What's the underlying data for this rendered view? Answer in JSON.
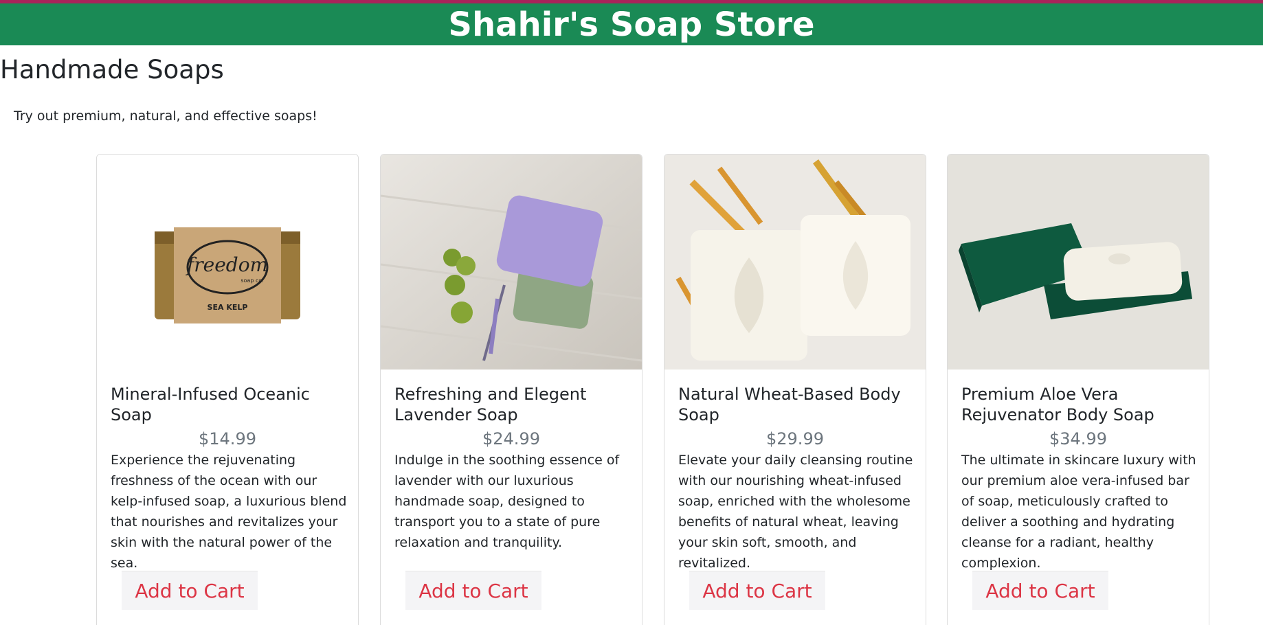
{
  "header": {
    "title": "Shahir's Soap Store"
  },
  "page": {
    "heading": "Handmade Soaps",
    "tagline": "Try out premium, natural, and effective soaps!"
  },
  "products": [
    {
      "title": "Mineral-Infused Oceanic Soap",
      "price": "$14.99",
      "description": "Experience the rejuvenating freshness of the ocean with our kelp-infused soap, a luxurious blend that nourishes and revitalizes your skin with the natural power of the sea.",
      "button": "Add to Cart",
      "image_label": "freedom",
      "image_label_small": "soap co.",
      "image_label_sub": "SEA KELP"
    },
    {
      "title": "Refreshing and Elegent Lavender Soap",
      "price": "$24.99",
      "description": "Indulge in the soothing essence of lavender with our luxurious handmade soap, designed to transport you to a state of pure relaxation and tranquility.",
      "button": "Add to Cart"
    },
    {
      "title": "Natural Wheat-Based Body Soap",
      "price": "$29.99",
      "description": "Elevate your daily cleansing routine with our nourishing wheat-infused soap, enriched with the wholesome benefits of natural wheat, leaving your skin soft, smooth, and revitalized.",
      "button": "Add to Cart"
    },
    {
      "title": "Premium Aloe Vera Rejuvenator Body Soap",
      "price": "$34.99",
      "description": "The ultimate in skincare luxury with our premium aloe vera-infused bar of soap, meticulously crafted to deliver a soothing and hydrating cleanse for a radiant, healthy complexion.",
      "button": "Add to Cart"
    }
  ],
  "colors": {
    "header_bg": "#1a8a55",
    "top_stripe": "#a8245a",
    "price": "#6c757d",
    "button_text": "#dc3545"
  }
}
